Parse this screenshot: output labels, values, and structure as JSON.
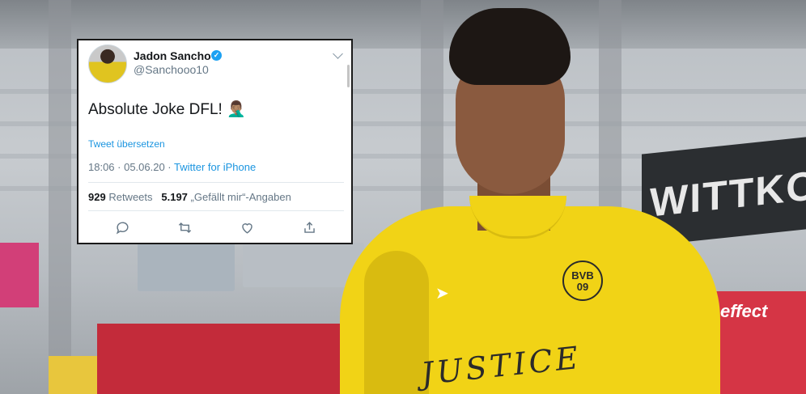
{
  "tweet": {
    "name": "Jadon Sancho",
    "handle": "@Sanchooo10",
    "text": "Absolute Joke DFL! 🤦🏽‍♂️",
    "translate_label": "Tweet übersetzen",
    "time": "18:06 · 05.06.20 · ",
    "source": "Twitter for iPhone",
    "retweet_count": "929",
    "retweet_label": "Retweets",
    "like_count": "5.197",
    "like_label": "„Gefällt mir“-Angaben",
    "actions": [
      "reply-icon",
      "retweet-icon",
      "like-icon",
      "share-icon"
    ],
    "accent_color": "#1da1f2"
  },
  "background": {
    "sign_text": "WITTKOPF",
    "effect_text": "effect",
    "badge_text_top": "BVB",
    "badge_text_bottom": "09",
    "shirt_text": "JUSTICE",
    "shirt_color": "#f1d316"
  }
}
